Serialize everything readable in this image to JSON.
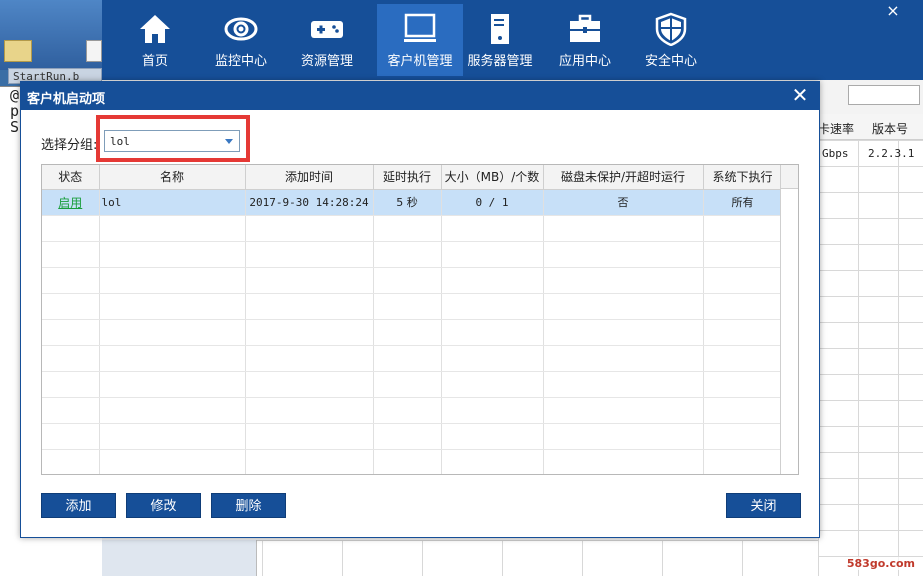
{
  "background": {
    "taskbar_text": "StartRun.b",
    "editor_lines": [
      "@",
      "p",
      "S"
    ],
    "right_table": {
      "headers": [
        "卡速率",
        "版本号"
      ],
      "row": [
        "Gbps",
        "2.2.3.1"
      ]
    },
    "watermark": "583go.com"
  },
  "header": {
    "nav": [
      {
        "label": "首页",
        "icon": "home-icon"
      },
      {
        "label": "监控中心",
        "icon": "eye-icon"
      },
      {
        "label": "资源管理",
        "icon": "gamepad-icon"
      },
      {
        "label": "客户机管理",
        "icon": "monitor-icon"
      },
      {
        "label": "服务器管理",
        "icon": "server-icon"
      },
      {
        "label": "应用中心",
        "icon": "toolbox-icon"
      },
      {
        "label": "安全中心",
        "icon": "shield-icon"
      }
    ],
    "active_index": 3,
    "close_glyph": "×"
  },
  "dialog": {
    "title": "客户机启动项",
    "close_glyph": "✕",
    "group_label": "选择分组:",
    "group_value": "lol",
    "table": {
      "columns": [
        "状态",
        "名称",
        "添加时间",
        "延时执行",
        "大小（MB）/个数",
        "磁盘未保护/开超时运行",
        "系统下执行"
      ],
      "rows": [
        [
          "启用",
          "lol",
          "2017-9-30 14:28:24",
          "5 秒",
          "0 / 1",
          "否",
          "所有"
        ]
      ]
    },
    "buttons": {
      "add": "添加",
      "edit": "修改",
      "delete": "删除",
      "close": "关闭"
    }
  },
  "colors": {
    "primary": "#164f98",
    "active_nav": "#2a6cc0",
    "highlight": "#e53935",
    "selected_row": "#c7e0f8",
    "status_green": "#1a9e3b"
  }
}
